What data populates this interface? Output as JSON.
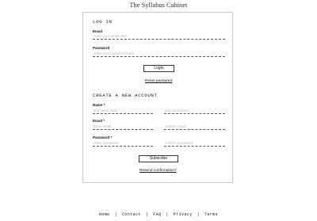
{
  "site": {
    "title": "The Syllabus Cabinet"
  },
  "login": {
    "heading": "LOG IN",
    "email_label": "Email",
    "email_placeholder": "enter your email here",
    "password_label": "Password",
    "password_placeholder": "enter your password here",
    "login_button": "Login",
    "reset_link": "Reset password"
  },
  "register": {
    "heading": "CREATE A NEW ACCOUNT",
    "name_label": "Name *",
    "first_name_placeholder": "first name here",
    "last_name_placeholder": "last name here",
    "email_label": "Email *",
    "email_placeholder": "enter email",
    "confirm_email_placeholder": "confirm email",
    "password_label": "Password *",
    "password_placeholder": "enter password",
    "confirm_password_placeholder": "confirm password",
    "subscribe_button": "Subscribe",
    "resend_link": "Resend confirmation?"
  },
  "footer": {
    "links": [
      "Home",
      "Contact",
      "FAQ",
      "Privacy",
      "Terms"
    ],
    "separator": "|"
  }
}
